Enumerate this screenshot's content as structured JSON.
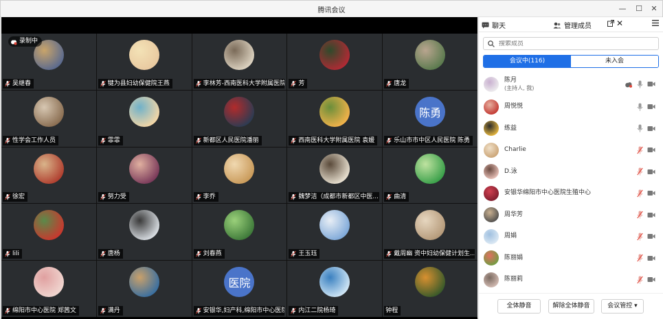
{
  "window": {
    "title": "腾讯会议",
    "minimize": "—",
    "maximize": "☐",
    "close": "✕"
  },
  "video": {
    "recording_label": "录制中",
    "tiles": [
      {
        "name": "吴继春",
        "avatar": "photo",
        "colors": [
          "#5b6a8e",
          "#c9a46a"
        ],
        "mic": "on"
      },
      {
        "name": "犍为县妇幼保健院王燕",
        "avatar": "photo",
        "colors": [
          "#e9c9a0",
          "#f3e2b6"
        ],
        "mic": "on"
      },
      {
        "name": "李林芳-西南医科大学附属医院",
        "avatar": "photo",
        "colors": [
          "#dcd2c0",
          "#7a6a58"
        ],
        "mic": "on"
      },
      {
        "name": "芳",
        "avatar": "photo",
        "colors": [
          "#b02a34",
          "#2f4a2b"
        ],
        "mic": "on"
      },
      {
        "name": "唐龙",
        "avatar": "photo",
        "colors": [
          "#5b7a4e",
          "#b9a58f"
        ],
        "mic": "on"
      },
      {
        "name": "性学会工作人员",
        "avatar": "photo",
        "colors": [
          "#8a6e52",
          "#d7c7b2"
        ],
        "mic": "on"
      },
      {
        "name": "霏霏",
        "avatar": "photo",
        "colors": [
          "#f3d6a6",
          "#6fb1c9"
        ],
        "mic": "on"
      },
      {
        "name": "新都区人民医院潘丽",
        "avatar": "photo",
        "colors": [
          "#2d3b52",
          "#b22b2b"
        ],
        "mic": "on"
      },
      {
        "name": "西南医科大学附属医院 袁媛",
        "avatar": "photo",
        "colors": [
          "#f2b24a",
          "#6a8e3a"
        ],
        "mic": "on"
      },
      {
        "name": "乐山市市中区人民医院 陈勇",
        "avatar": "text",
        "text": "陈勇",
        "colors": [
          "#4a74c9",
          "#4a74c9"
        ],
        "mic": "on"
      },
      {
        "name": "徐宏",
        "avatar": "photo",
        "colors": [
          "#b04030",
          "#d9b48a"
        ],
        "mic": "on"
      },
      {
        "name": "努力受",
        "avatar": "photo",
        "colors": [
          "#7a3a5a",
          "#e0b0a0"
        ],
        "mic": "on"
      },
      {
        "name": "李乔",
        "avatar": "photo",
        "colors": [
          "#c99a5a",
          "#f0d8b0"
        ],
        "mic": "on"
      },
      {
        "name": "魏梦洁（成都市新都区中医...",
        "avatar": "photo",
        "colors": [
          "#e8e0d0",
          "#5a4a3a"
        ],
        "mic": "on"
      },
      {
        "name": "曲清",
        "avatar": "photo",
        "colors": [
          "#3aa04a",
          "#bfe2a0"
        ],
        "mic": "on"
      },
      {
        "name": "lili",
        "avatar": "photo",
        "colors": [
          "#c9382e",
          "#5a8a4a"
        ],
        "mic": "on"
      },
      {
        "name": "唐杨",
        "avatar": "photo",
        "colors": [
          "#d8dde2",
          "#3a3a3a"
        ],
        "mic": "on"
      },
      {
        "name": "刘春燕",
        "avatar": "photo",
        "colors": [
          "#3f7a3a",
          "#9ad07a"
        ],
        "mic": "on"
      },
      {
        "name": "王玉珏",
        "avatar": "photo",
        "colors": [
          "#7fa9d9",
          "#e8eef5"
        ],
        "mic": "on"
      },
      {
        "name": "戴周幽 资中妇幼保健计划生...",
        "avatar": "photo",
        "colors": [
          "#b59a7a",
          "#e6d6bf"
        ],
        "mic": "on"
      },
      {
        "name": "绵阳市中心医院 郑茜文",
        "avatar": "photo",
        "colors": [
          "#f0d6d0",
          "#e0a0a0"
        ],
        "mic": "on"
      },
      {
        "name": "满丹",
        "avatar": "photo",
        "colors": [
          "#3a6fa0",
          "#c9a06a"
        ],
        "mic": "on"
      },
      {
        "name": "安银华,妇产科,绵阳市中心医院",
        "avatar": "text",
        "text": "医院",
        "colors": [
          "#4a74c9",
          "#4a74c9"
        ],
        "mic": "on"
      },
      {
        "name": "内江二院杨琦",
        "avatar": "photo",
        "colors": [
          "#d0e6f5",
          "#3a80c0"
        ],
        "mic": "on"
      },
      {
        "name": "钟程",
        "avatar": "photo",
        "colors": [
          "#3a5a2a",
          "#d89030"
        ],
        "mic": "none"
      }
    ]
  },
  "panel": {
    "tab_chat": "聊天",
    "tab_members": "管理成员",
    "search_placeholder": "搜索成员",
    "seg_in": "会议中(116)",
    "seg_out": "未入会",
    "members": [
      {
        "name": "陈月",
        "sub": "(主持人, 我)",
        "colors": [
          "#f0f0f0",
          "#c9b0d0"
        ],
        "rec": true,
        "mic": "on"
      },
      {
        "name": "周悦悦",
        "colors": [
          "#c0302a",
          "#e6b0a0"
        ],
        "mic": "on"
      },
      {
        "name": "练益",
        "colors": [
          "#f2c040",
          "#2a2a2a"
        ],
        "mic": "on"
      },
      {
        "name": "Charlie",
        "colors": [
          "#c8a070",
          "#f0e0c8"
        ],
        "mic": "muted"
      },
      {
        "name": "D.泳",
        "colors": [
          "#f0c8c0",
          "#6a4a40"
        ],
        "mic": "muted"
      },
      {
        "name": "安银华绵阳市中心医院生殖中心",
        "colors": [
          "#7a1a2a",
          "#d04050"
        ],
        "mic": "muted"
      },
      {
        "name": "周华芳",
        "colors": [
          "#4a4a4a",
          "#c9b090"
        ],
        "mic": "muted"
      },
      {
        "name": "周娟",
        "colors": [
          "#e0ecf5",
          "#a0c0e0"
        ],
        "mic": "muted"
      },
      {
        "name": "陈丽娟",
        "colors": [
          "#6aa040",
          "#e07060"
        ],
        "mic": "muted"
      },
      {
        "name": "陈丽莉",
        "colors": [
          "#d8c0b8",
          "#7a6a60"
        ],
        "mic": "muted"
      }
    ],
    "btn_mute_all": "全体静音",
    "btn_unmute_all": "解除全体静音",
    "btn_control": "会议管控 ▾"
  },
  "colors": {
    "accent": "#1f6fe6",
    "tile_bg": "#2a2d30",
    "muted_red": "#e0463a"
  }
}
